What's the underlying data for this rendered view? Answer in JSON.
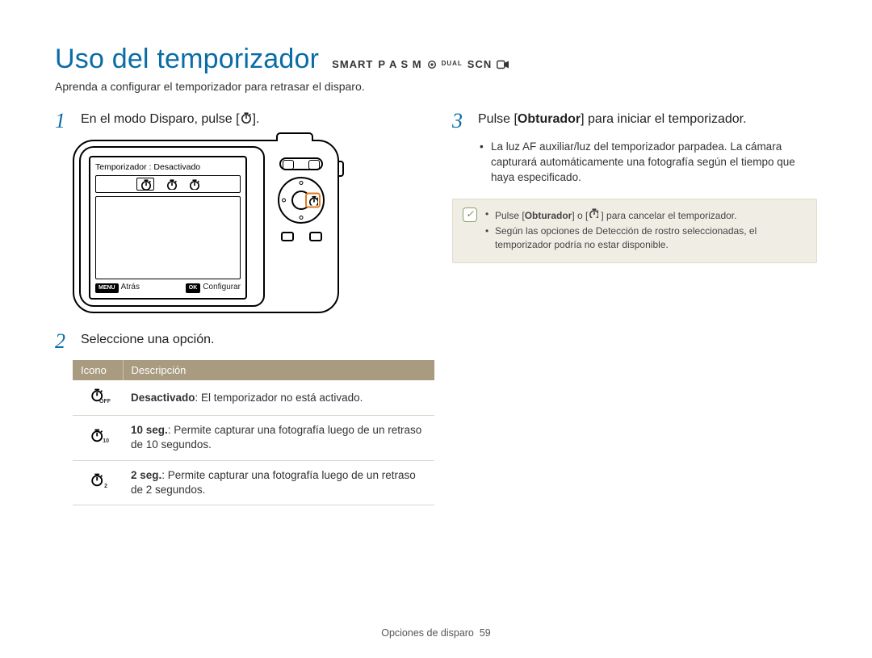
{
  "title": "Uso del temporizador",
  "mode_strip": {
    "smart": "SMART",
    "letters": "P A S M",
    "dual": "DUAL",
    "scn": "SCN"
  },
  "subtitle": "Aprenda a configurar el temporizador para retrasar el disparo.",
  "steps": {
    "s1": {
      "num": "1",
      "text_a": "En el modo Disparo, pulse [",
      "text_b": "]."
    },
    "s2": {
      "num": "2",
      "text": "Seleccione una opción."
    },
    "s3": {
      "num": "3",
      "text_a": "Pulse [",
      "bold": "Obturador",
      "text_b": "] para iniciar el temporizador.",
      "bullet": "La luz AF auxiliar/luz del temporizador parpadea. La cámara capturará automáticamente una fotografía según el tiempo que haya especificado."
    }
  },
  "lcd": {
    "title": "Temporizador : Desactivado",
    "back_key": "MENU",
    "back_label": "Atrás",
    "ok_key": "OK",
    "ok_label": "Configurar"
  },
  "table": {
    "h_icon": "Icono",
    "h_desc": "Descripción",
    "rows": [
      {
        "sub": "OFF",
        "bold": "Desactivado",
        "rest": ": El temporizador no está activado."
      },
      {
        "sub": "10",
        "bold": "10 seg.",
        "rest": ": Permite capturar una fotografía luego de un retraso de 10 segundos."
      },
      {
        "sub": "2",
        "bold": "2 seg.",
        "rest": ": Permite capturar una fotografía luego de un retraso de 2 segundos."
      }
    ]
  },
  "tips": {
    "l1a": "Pulse [",
    "l1b": "Obturador",
    "l1c": "] o [",
    "l1d": "] para cancelar el temporizador.",
    "l2": "Según las opciones de Detección de rostro seleccionadas, el temporizador podría no estar disponible."
  },
  "footer": {
    "section": "Opciones de disparo",
    "page": "59"
  }
}
